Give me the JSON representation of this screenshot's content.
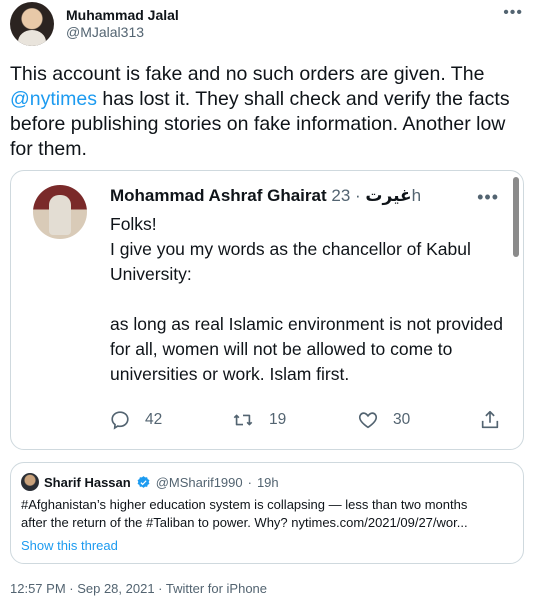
{
  "author": {
    "name": "Muhammad Jalal",
    "handle": "@MJalal313"
  },
  "tweet": {
    "text_before": "This account is fake and no such orders are given. The ",
    "mention": "@nytimes",
    "text_after": " has lost it. They shall check and verify the facts before publishing stories on fake information. Another low for them."
  },
  "embed": {
    "name": "Mohammad Ashraf Ghairat",
    "name_arabic": "غیرت",
    "meta": "· 23h",
    "text": "Folks!\nI give you my words as the chancellor of Kabul University:\n\nas long as real Islamic environment is not provided for all, women will not be allowed to come to universities or work. Islam first.",
    "replies": "42",
    "retweets": "19",
    "likes": "30"
  },
  "quote": {
    "name": "Sharif Hassan",
    "handle": "@MSharif1990",
    "separator": "·",
    "time": "19h",
    "line1": "#Afghanistan’s higher education system is collapsing — less than two months",
    "line2": "after the return of the #Taliban to power. Why?  nytimes.com/2021/09/27/wor...",
    "show_thread": "Show this thread"
  },
  "footer": {
    "timestamp": "12:57 PM · Sep 28, 2021 · Twitter for iPhone"
  },
  "colors": {
    "accent": "#1d9bf0",
    "secondary_text": "#536471",
    "border": "#cfd9de"
  },
  "icons": [
    "more-icon",
    "reply-icon",
    "retweet-icon",
    "like-icon",
    "share-icon",
    "verified-icon"
  ]
}
